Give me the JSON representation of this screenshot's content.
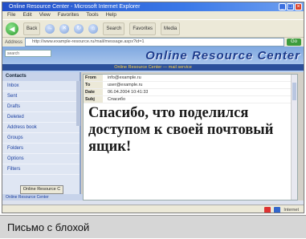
{
  "window": {
    "title": "Online Resource Center - Microsoft Internet Explorer",
    "buttons": [
      "_",
      "□",
      "×"
    ]
  },
  "menu": [
    "File",
    "Edit",
    "View",
    "Favorites",
    "Tools",
    "Help"
  ],
  "toolbar": {
    "back_label": "Back",
    "forward_label": "→",
    "search_label": "Search",
    "favorites_label": "Favorites",
    "media_label": "Media"
  },
  "address": {
    "label": "Address",
    "value": "http://www.example-resource.ru/mail/message.aspx?id=1",
    "go_label": "Go"
  },
  "banner": {
    "search_placeholder": "search",
    "title": "Online Resource Center",
    "subtitle": "Online Resource Center — mail service"
  },
  "sidebar": {
    "header": "Contacts",
    "items": [
      "Inbox",
      "Sent",
      "Drafts",
      "Deleted",
      "Address book",
      "Groups",
      "Folders",
      "Options",
      "Filters"
    ],
    "ok_label": "Online Resource C",
    "footer": "Online Resource Center"
  },
  "mail": {
    "headers": [
      {
        "label": "From",
        "value": "info@example.ru"
      },
      {
        "label": "To",
        "value": "user@example.ru"
      },
      {
        "label": "Date",
        "value": "06.04.2004 10:41:33"
      },
      {
        "label": "Subj",
        "value": "Спасибо"
      }
    ],
    "body": "Спасибо, что поделился доступом к своей почтовый ящик!"
  },
  "statusbar": {
    "text": "",
    "zone_label": "Internet"
  },
  "caption": "Письмо с блохой",
  "colors": {
    "titlebar": "#2350c8",
    "banner_title": "#1e3c8c",
    "caption_bg": "#d6d6d6"
  }
}
